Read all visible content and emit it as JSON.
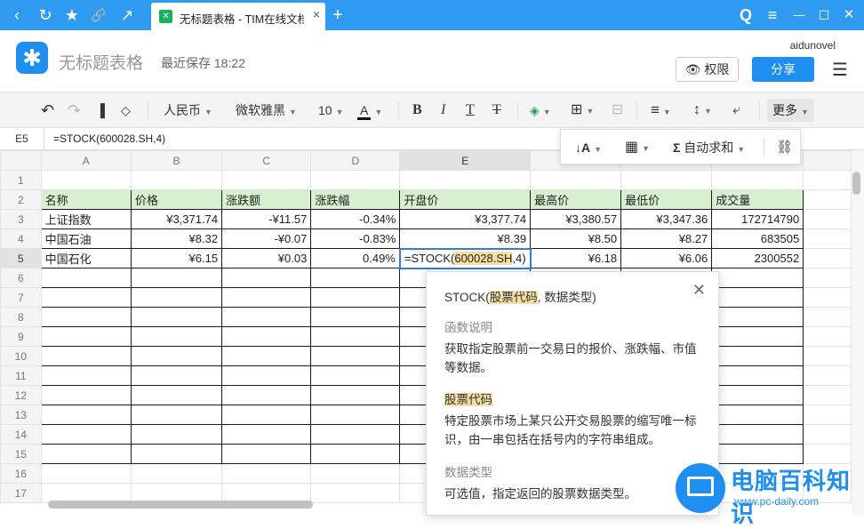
{
  "browser": {
    "tab_title": "无标题表格 - TIM在线文档",
    "tab_favicon_text": "✕",
    "back_icon": "‹",
    "refresh_icon": "↻",
    "bookmark_icon": "★",
    "link_icon": "🔗",
    "share_icon": "↗",
    "close_tab": "×",
    "new_tab": "+",
    "search_icon": "Q",
    "menu_icon": "≡",
    "minimize": "—",
    "maximize": "☐",
    "close": "✕"
  },
  "header": {
    "doc_title": "无标题表格",
    "save_status": "最近保存  18:22",
    "username": "aidunovel",
    "permission_label": "权限",
    "share_label": "分享",
    "logo_glyph": "✱"
  },
  "toolbar": {
    "undo": "↶",
    "redo": "↷",
    "format_painter": "🖌",
    "clear": "⌫",
    "currency": "人民币",
    "font": "微软雅黑",
    "font_size": "10",
    "font_color": "A",
    "bold": "B",
    "italic": "I",
    "underline": "T",
    "strike": "T",
    "fill": "◈",
    "border": "⊞",
    "merge": "⊟",
    "align": "≡",
    "valign": "↕",
    "wrap": "⤶",
    "more": "更多"
  },
  "more_menu": {
    "sort": "↓A",
    "filter": "▦",
    "autosum_label": "自动求和",
    "sigma": "Σ",
    "link": "⛓"
  },
  "formula_bar": {
    "cell_ref": "E5",
    "formula": "=STOCK(600028.SH,4)"
  },
  "grid": {
    "columns": [
      "A",
      "B",
      "C",
      "D",
      "E",
      "F",
      "G",
      "H"
    ],
    "rows": [
      "1",
      "2",
      "3",
      "4",
      "5",
      "6",
      "7",
      "8",
      "9",
      "10",
      "11",
      "12",
      "13",
      "14",
      "15",
      "16",
      "17"
    ],
    "header_row": [
      "名称",
      "价格",
      "涨跌额",
      "涨跌幅",
      "开盘价",
      "最高价",
      "最低价",
      "成交量"
    ],
    "data": [
      [
        "上证指数",
        "¥3,371.74",
        "-¥11.57",
        "-0.34%",
        "¥3,377.74",
        "¥3,380.57",
        "¥3,347.36",
        "172714790"
      ],
      [
        "中国石油",
        "¥8.32",
        "-¥0.07",
        "-0.83%",
        "¥8.39",
        "¥8.50",
        "¥8.27",
        "683505"
      ],
      [
        "中国石化",
        "¥6.15",
        "¥0.03",
        "0.49%",
        "",
        "¥6.18",
        "¥6.06",
        "2300552"
      ]
    ],
    "active_formula_prefix": "=STOCK(",
    "active_formula_arg": "600028.SH",
    "active_formula_suffix": ",4)"
  },
  "tooltip": {
    "signature_prefix": "STOCK(",
    "signature_highlight": "股票代码",
    "signature_suffix": ", 数据类型)",
    "section1_title": "函数说明",
    "section1_body": "获取指定股票前一交易日的报价、涨跌幅、市值等数据。",
    "section2_title": "股票代码",
    "section2_body": "特定股票市场上某只公开交易股票的缩写唯一标识，由一串包括在括号内的字符串组成。",
    "section3_title": "数据类型",
    "section3_body": "可选值，指定返回的股票数据类型。"
  },
  "watermark": {
    "text": "电脑百科知识",
    "url": "www.pc-daily.com"
  },
  "colors": {
    "chrome": "#2f9bf0",
    "accent": "#1e8ef0",
    "header_fill": "#d7f0cf",
    "arg_highlight": "#f4dea4"
  }
}
